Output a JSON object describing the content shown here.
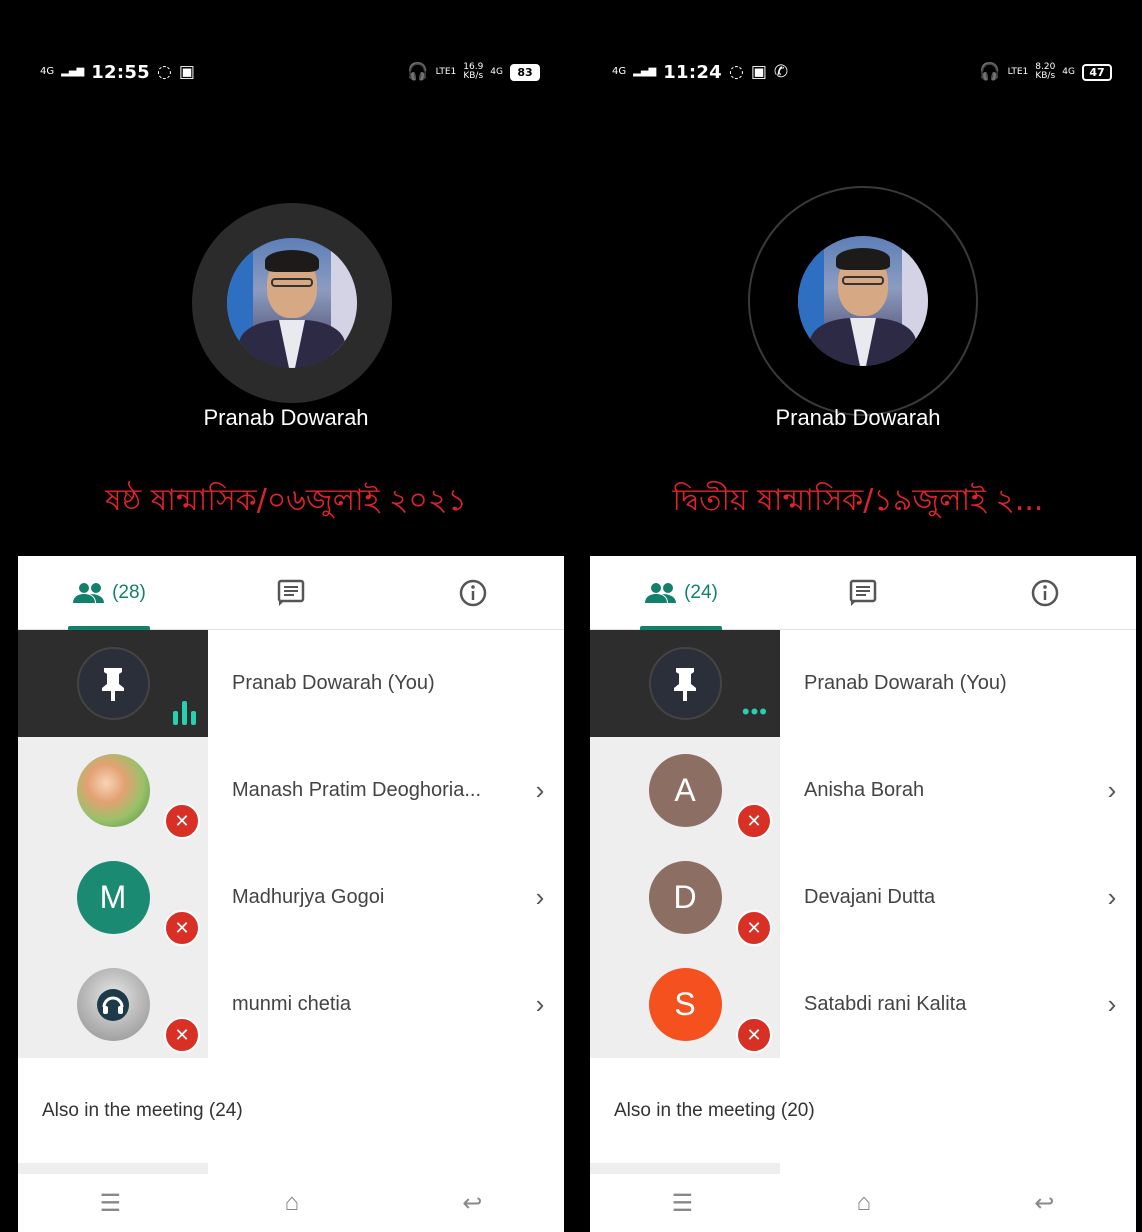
{
  "phones": [
    {
      "status": {
        "signal_left": "4G",
        "time": "12:55",
        "net": "LTE1",
        "speed": "16.9",
        "speed_unit": "KB/s",
        "net2": "4G",
        "battery": "83"
      },
      "speaker": {
        "name": "Pranab Dowarah"
      },
      "meeting_title": "ষষ্ঠ ষান্মাসিক/০৬জুলাই ২০২১",
      "tabs": {
        "people_count": "(28)"
      },
      "participants": [
        {
          "name": "Pranab Dowarah (You)"
        },
        {
          "name": "Manash Pratim Deoghoria..."
        },
        {
          "name": "Madhurjya Gogoi",
          "initial": "M",
          "color": "#1a8a73"
        },
        {
          "name": "munmi chetia"
        }
      ],
      "also": "Also in the meeting (24)"
    },
    {
      "status": {
        "signal_left": "4G",
        "time": "11:24",
        "net": "LTE1",
        "speed": "8.20",
        "speed_unit": "KB/s",
        "net2": "4G",
        "battery": "47"
      },
      "speaker": {
        "name": "Pranab Dowarah"
      },
      "meeting_title": "দ্বিতীয় ষান্মাসিক/১৯জুলাই ২...",
      "tabs": {
        "people_count": "(24)"
      },
      "participants": [
        {
          "name": "Pranab Dowarah (You)"
        },
        {
          "name": "Anisha Borah",
          "initial": "A",
          "color": "#8d6e63"
        },
        {
          "name": "Devajani Dutta",
          "initial": "D",
          "color": "#8d6e63"
        },
        {
          "name": "Satabdi rani Kalita",
          "initial": "S",
          "color": "#f4511e"
        }
      ],
      "also": "Also in the meeting (20)"
    }
  ]
}
